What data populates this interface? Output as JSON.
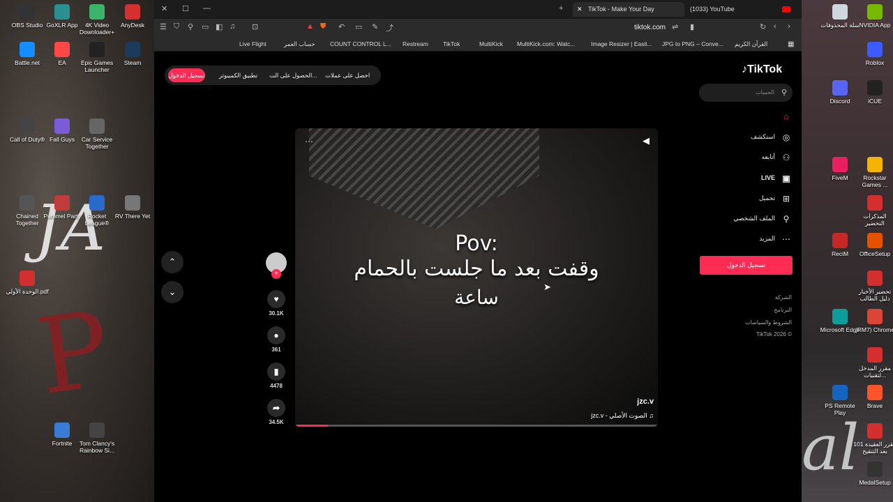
{
  "desktop_left": [
    {
      "label": "OBS Studio",
      "color": "#333333"
    },
    {
      "label": "GoXLR App",
      "color": "#2a8f8f"
    },
    {
      "label": "4K Video Downloader+",
      "color": "#3bb36b"
    },
    {
      "label": "AnyDesk",
      "color": "#d5302f"
    },
    {
      "label": "Battle.net",
      "color": "#148eff"
    },
    {
      "label": "EA",
      "color": "#ff4747"
    },
    {
      "label": "Epic Games Launcher",
      "color": "#222222"
    },
    {
      "label": "Steam",
      "color": "#1b3a5c"
    },
    {
      "label": "Call of Duty®",
      "color": "#444444"
    },
    {
      "label": "Fall Guys",
      "color": "#7b5cd6"
    },
    {
      "label": "Car Service Together",
      "color": "#666666"
    },
    {
      "label": "Chained Together",
      "color": "#555555"
    },
    {
      "label": "Pummel Party",
      "color": "#c23b3b"
    },
    {
      "label": "Rocket League®",
      "color": "#2a6acb"
    },
    {
      "label": "RV There Yet",
      "color": "#777777"
    },
    {
      "label": "الوحدة الأولى.pdf",
      "color": "#d32f2f"
    },
    {
      "label": "Fortnite",
      "color": "#3a7bd5"
    },
    {
      "label": "Tom Clancy's Rainbow Si...",
      "color": "#444444"
    }
  ],
  "desktop_right": [
    {
      "label": "سلة المحذوفات",
      "color": "#cfd8dc"
    },
    {
      "label": "NVIDIA App",
      "color": "#76b900"
    },
    {
      "label": "Roblox",
      "color": "#3d5afe"
    },
    {
      "label": "Discord",
      "color": "#5865f2"
    },
    {
      "label": "iCUE",
      "color": "#222222"
    },
    {
      "label": "FiveM",
      "color": "#e91e63"
    },
    {
      "label": "Rockstar Games ...",
      "color": "#f4b400"
    },
    {
      "label": "المذكرات التحضير",
      "color": "#d32f2f"
    },
    {
      "label": "ReciM",
      "color": "#c62828"
    },
    {
      "label": "OfficeSetup",
      "color": "#e65100"
    },
    {
      "label": "تحضير الأخبار دليل الطالب",
      "color": "#d32f2f"
    },
    {
      "label": "Microsoft Edge",
      "color": "#0f9d9a"
    },
    {
      "label": "(RM7) Chrome",
      "color": "#db4437"
    },
    {
      "label": "مقرر المدخل لتقنيات...",
      "color": "#d32f2f"
    },
    {
      "label": "PS Remote Play",
      "color": "#1565c0"
    },
    {
      "label": "Brave",
      "color": "#fb542b"
    },
    {
      "label": "مقرر العقيدة 101 بعد التنقيح",
      "color": "#d32f2f"
    },
    {
      "label": "MedalSetup",
      "color": "#333333"
    }
  ],
  "desktop_art": {
    "left_letters": "JA",
    "left_red": "P",
    "right_script": "al"
  },
  "tabs": [
    {
      "label": "TikTok - Make Your Day",
      "active": true
    },
    {
      "label": "(1033) YouTube",
      "active": false
    }
  ],
  "address": "tiktok.com",
  "bookmarks": [
    "Live Flight",
    "حساب العمر",
    "COUNT CONTROL L...",
    "Restream",
    "TikTok",
    "MultiKick",
    "MultiKick.com: Watc...",
    "Image Resizer | Easil...",
    "JPG to PNG – Conve...",
    "القرآن الكريم"
  ],
  "tiktok": {
    "logo": "TikTok",
    "search_placeholder": "الحساب",
    "top_pill": {
      "login": "تسجيل الدخول",
      "get_app": "تطبيق الكمبيوتر",
      "get_app2": "الحصول على الت...",
      "coins": "احصل على عملات"
    },
    "nav": [
      {
        "label": "",
        "icon": "home-icon",
        "active": true
      },
      {
        "label": "استكشف",
        "icon": "compass-icon"
      },
      {
        "label": "أتابعه",
        "icon": "following-icon"
      },
      {
        "label": "LIVE",
        "icon": "live-icon"
      },
      {
        "label": "تحميل",
        "icon": "upload-icon"
      },
      {
        "label": "الملف الشخصي",
        "icon": "profile-icon"
      },
      {
        "label": "المزيد",
        "icon": "more-icon"
      }
    ],
    "nav_login": "تسجيل الدخول",
    "footer": [
      "الشركة",
      "البرنامج",
      "الشروط والسياسات",
      "TikTok 2026 ©"
    ],
    "video": {
      "line1": "Pov:",
      "line2": "وقفت بعد ما جلست بالحمام",
      "line3": "ساعة",
      "username": "jzc.v",
      "music": "jzc.v - الصوت الأصلي",
      "progress": 0.09
    },
    "actions": {
      "likes": "30.1K",
      "comments": "361",
      "saves": "4478",
      "shares": "34.5K"
    }
  }
}
